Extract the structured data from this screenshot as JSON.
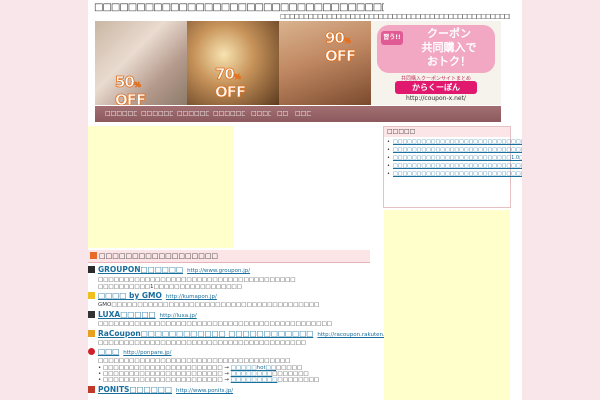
{
  "header": {
    "site_title": "□□□□□□□□□□□□□□□□□□□□□□□□□□□□□□□□□□□□□□□",
    "tagline": "□□□□□□□□□□□□□□□□□□□□□□□□□□□□□□□□□□□□□□□□□□□□□□□□□□□□□□□□□□□□□□□□"
  },
  "banner": {
    "discounts": [
      "50",
      "70",
      "90"
    ],
    "off_label": "OFF",
    "pct_label": "%",
    "slogan_badge": "習う!!",
    "slogan": "クーポン\n共同購入で\nおトク！",
    "brand_sub": "共同購入クーポンサイトまとめ",
    "brand_logo": "からくーぽん",
    "brand_url": "http://coupon-x.net/"
  },
  "nav": {
    "items": [
      "□□□□□□□",
      "□□□□□□□",
      "□□□□□□□",
      "□□□□□□□",
      "□□□□",
      "□□",
      "□□□"
    ]
  },
  "main": {
    "section_title": "□□□□□□□□□□□□□□□□□□",
    "sites": [
      {
        "name": "GROUPON□□□□□□",
        "url": "http://www.groupon.jp/",
        "desc": [
          "□□□□□□□□□□□□□□□□□□□□□□□□□□□□□□□□□□□□□□",
          "□□□□□□□□□□1□□□□□□□□□□□□□□□□□"
        ]
      },
      {
        "name": "□□□□ by GMO",
        "url": "http://kumapon.jp/",
        "desc": [
          "GMO□□□□□□□□□□□□□□□□□□□□□□□□□□□□□□□□□□□□□□□□"
        ]
      },
      {
        "name": "LUXA□□□□□",
        "url": "http://luxa.jp/",
        "desc": [
          "□□□□□□□□□□□□□□□□□□□□□□□□□□□□□□□□□□□□□□□□□□□□□"
        ]
      },
      {
        "name": "RaCoupon□□□□□□□□□□□□ □□□□□□□□□□□□",
        "url": "http://racoupon.rakuten.co.jp/",
        "desc": [
          "□□□□□□□□□□□□□□□□□□□□□□□□□□□□□□□□□□□□□□□□"
        ]
      },
      {
        "name": "□□□",
        "url": "http://ponpare.jp/",
        "desc": [
          "□□□□□□□□□□□□□□□□□□□□□□□□□□□□□□□□□□□□□"
        ],
        "bullets": [
          {
            "text": "□□□□□□□□□□□□□□□□□□□□□□□ →",
            "link": "□□□□□hot□□",
            "after": "□□□□□"
          },
          {
            "text": "□□□□□□□□□□□□□□□□□□□□□□□ →",
            "link": "□□□□□□□□",
            "after": "□□□□□□□"
          },
          {
            "text": "□□□□□□□□□□□□□□□□□□□□□□□ →",
            "link": "□□□□□□□□□",
            "after": "□□□□□□□□"
          }
        ]
      },
      {
        "name": "PONITS□□□□□□",
        "url": "http://www.ponits.jp/",
        "desc": []
      }
    ]
  },
  "sidebar": {
    "heading": "□□□□□",
    "links": [
      "□□□□□□□□□□□□□□□□□□□□□□□□□□□□□□□□□□□□□□□□□□□",
      "□□□□□□□□□□□□□□□□□□□□□□□□□□□□□□□□□□□□□□□□□□□□□",
      "□□□□□□□□□□□□□□□□□□□□□□□□□1.0□□□□□□□□□□□□□□□□",
      "□□□□□□□□□□□□□□□□□□□□□□□□□□□□□□□□□□□□□□□□□",
      "□□□□□□□□□□□□□□□□□□□□□□□□□□□□□□□□□□□□□□□□"
    ]
  },
  "colors": {
    "page_bg": "#f8e6ea",
    "nav_bg": "#98666a",
    "link": "#1a6e9c",
    "ad_bg": "#ffffcc",
    "section_bg": "#fbe5e6"
  },
  "icons": [
    "rss-icon",
    "groupon-icon",
    "kumapon-icon",
    "luxa-icon",
    "racoupon-icon",
    "ponpare-icon",
    "ponits-icon"
  ]
}
